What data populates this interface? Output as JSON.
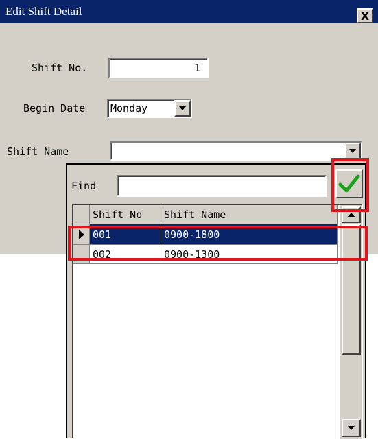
{
  "dialog": {
    "title": "Edit Shift Detail",
    "close_label": "X",
    "shift_no_label": "Shift No.",
    "shift_no_value": "1",
    "begin_date_label": "Begin Date",
    "begin_date_value": "Monday",
    "shift_name_label": "Shift Name",
    "shift_name_value": ""
  },
  "lookup": {
    "find_label": "Find",
    "find_value": "",
    "confirm_icon": "check-icon",
    "columns": [
      "Shift No",
      "Shift Name"
    ],
    "rows": [
      {
        "shift_no": "001",
        "shift_name": "0900-1800",
        "selected": true
      },
      {
        "shift_no": "002",
        "shift_name": "0900-1300",
        "selected": false
      }
    ]
  },
  "colors": {
    "title_bar": "#0a246a",
    "selection": "#0a246a",
    "annotation_red": "#e3141b",
    "check_green": "#1aa31a",
    "window_face": "#d4d0c8"
  }
}
